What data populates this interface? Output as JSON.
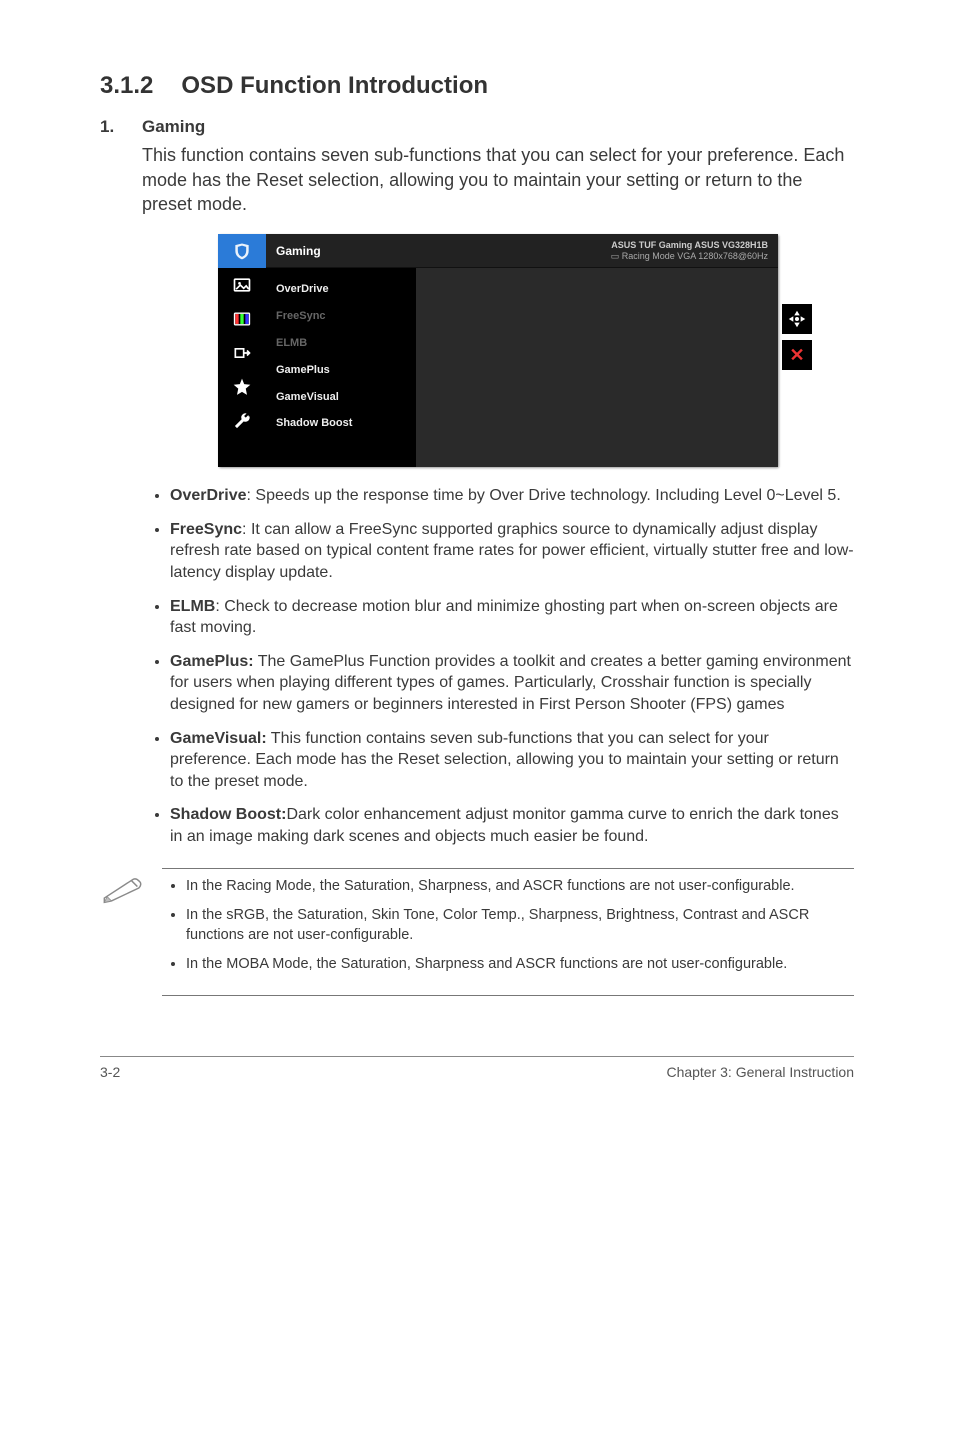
{
  "heading": {
    "num": "3.1.2",
    "title": "OSD Function Introduction"
  },
  "item1": {
    "index": "1.",
    "title": "Gaming",
    "intro": "This function contains seven sub-functions that you can select for your preference. Each mode has the Reset selection, allowing you to maintain your setting or return to the preset mode."
  },
  "osd": {
    "header_title": "Gaming",
    "header_line1": "ASUS TUF Gaming ASUS VG328H1B",
    "header_line2": "Racing Mode  VGA  1280x768@60Hz",
    "menu": [
      {
        "label": "OverDrive",
        "dim": false
      },
      {
        "label": "FreeSync",
        "dim": true
      },
      {
        "label": "ELMB",
        "dim": true
      },
      {
        "label": "GamePlus",
        "dim": false
      },
      {
        "label": "GameVisual",
        "dim": false
      },
      {
        "label": "Shadow Boost",
        "dim": false
      }
    ],
    "sidebar_icons": [
      "tuf-logo-icon",
      "image-icon",
      "color-bars-icon",
      "input-icon",
      "star-icon",
      "wrench-icon"
    ],
    "right_controls": {
      "nav": "◆",
      "close": "✕"
    }
  },
  "bullets": [
    {
      "term": "OverDrive",
      "sep": ": ",
      "text": "Speeds up the response time by Over Drive technology. Including Level 0~Level 5."
    },
    {
      "term": "FreeSync",
      "sep": ": ",
      "text": "It can allow a FreeSync supported graphics source to dynamically adjust display refresh rate based on typical content frame rates for power efficient, virtually stutter free and low-latency display update."
    },
    {
      "term": "ELMB",
      "sep": ": ",
      "text": "Check to decrease motion blur and minimize ghosting part when on-screen objects are fast moving."
    },
    {
      "term": "GamePlus:",
      "sep": " ",
      "text": "The GamePlus Function provides a toolkit and creates a better gaming environment for users when playing different types of games. Particularly, Crosshair function is specially designed for new gamers or beginners interested in First Person Shooter (FPS) games"
    },
    {
      "term": "GameVisual:",
      "sep": " ",
      "text": "This function contains seven sub-functions that you can select for your preference. Each mode has the Reset selection, allowing you to maintain your setting or return to the preset mode."
    },
    {
      "term": "Shadow Boost:",
      "sep": "",
      "text": "Dark color enhancement adjust monitor gamma curve to enrich the dark tones in an image making dark scenes and objects much easier be found."
    }
  ],
  "notes": [
    "In the Racing Mode, the Saturation, Sharpness, and ASCR functions are not user-configurable.",
    "In the sRGB, the Saturation, Skin Tone, Color Temp., Sharpness, Brightness, Contrast and ASCR functions are not user-configurable.",
    "In the MOBA Mode, the Saturation, Sharpness and ASCR functions are not user-configurable."
  ],
  "footer": {
    "left": "3-2",
    "right": "Chapter 3: General Instruction"
  }
}
